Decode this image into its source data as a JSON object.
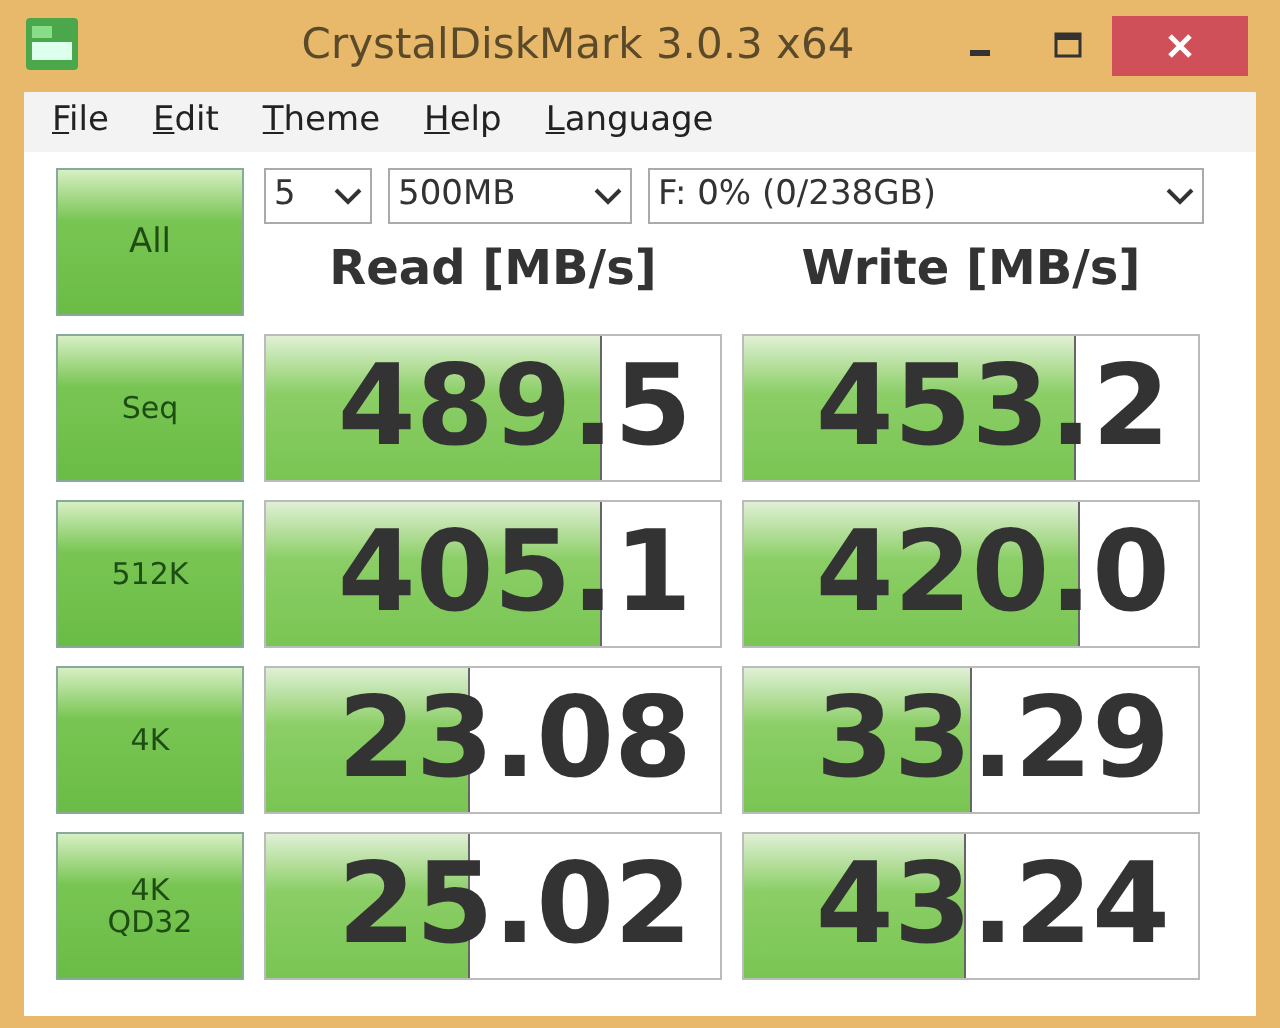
{
  "window": {
    "title": "CrystalDiskMark 3.0.3 x64"
  },
  "menu": [
    "File",
    "Edit",
    "Theme",
    "Help",
    "Language"
  ],
  "all_button": {
    "label": "All"
  },
  "selectors": [
    {
      "value": "5"
    },
    {
      "value": "500MB"
    },
    {
      "value": "F: 0% (0/238GB)"
    }
  ],
  "columns": [
    "Read [MB/s]",
    "Write [MB/s]"
  ],
  "tests": [
    {
      "label": [
        "Seq"
      ],
      "read": {
        "value": "489.5",
        "level": 0.74
      },
      "write": {
        "value": "453.2",
        "level": 0.73
      }
    },
    {
      "label": [
        "512K"
      ],
      "read": {
        "value": "405.1",
        "level": 0.74
      },
      "write": {
        "value": "420.0",
        "level": 0.74
      }
    },
    {
      "label": [
        "4K"
      ],
      "read": {
        "value": "23.08",
        "level": 0.45
      },
      "write": {
        "value": "33.29",
        "level": 0.5
      }
    },
    {
      "label": [
        "4K",
        "QD32"
      ],
      "read": {
        "value": "25.02",
        "level": 0.45
      },
      "write": {
        "value": "43.24",
        "level": 0.49
      }
    }
  ]
}
